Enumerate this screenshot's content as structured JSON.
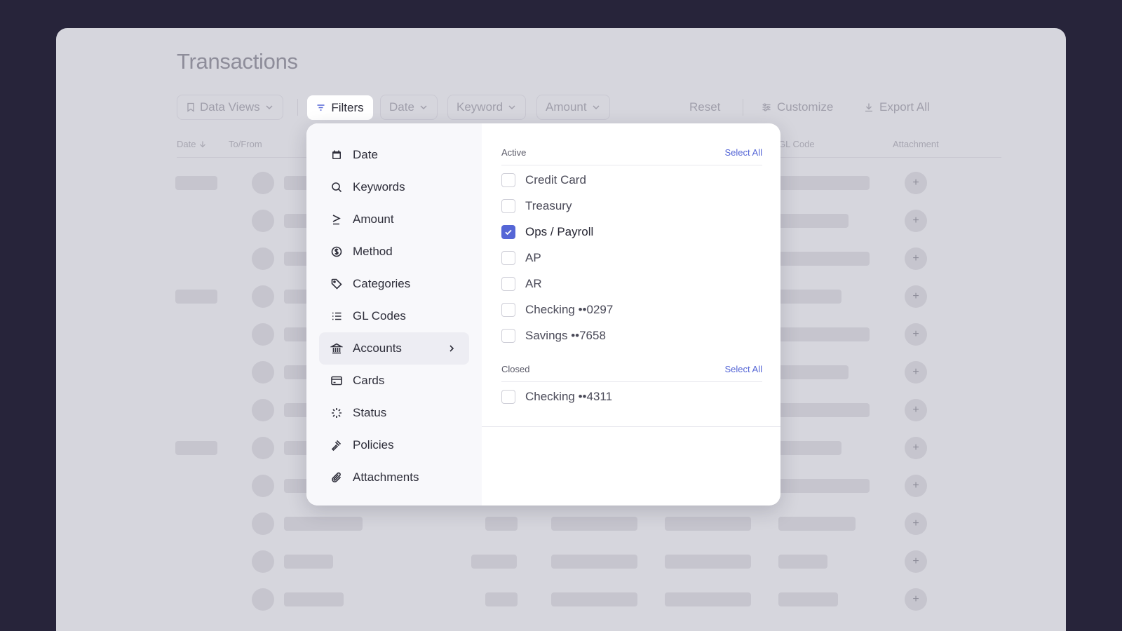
{
  "page": {
    "title": "Transactions"
  },
  "toolbar": {
    "data_views": "Data Views",
    "filters": "Filters",
    "date": "Date",
    "keyword": "Keyword",
    "amount": "Amount",
    "reset": "Reset",
    "customize": "Customize",
    "export_all": "Export All"
  },
  "table": {
    "headers": {
      "date": "Date",
      "to_from": "To/From",
      "gl_code": "GL Code",
      "attachment": "Attachment"
    },
    "add_symbol": "+"
  },
  "filter_menu": {
    "categories": [
      {
        "label": "Date",
        "icon": "calendar-icon"
      },
      {
        "label": "Keywords",
        "icon": "search-icon"
      },
      {
        "label": "Amount",
        "icon": "greater-equal-icon"
      },
      {
        "label": "Method",
        "icon": "dollar-circle-icon"
      },
      {
        "label": "Categories",
        "icon": "tag-icon"
      },
      {
        "label": "GL Codes",
        "icon": "list-icon"
      },
      {
        "label": "Accounts",
        "icon": "bank-icon",
        "active": true
      },
      {
        "label": "Cards",
        "icon": "card-icon"
      },
      {
        "label": "Status",
        "icon": "loader-icon"
      },
      {
        "label": "Policies",
        "icon": "gavel-icon"
      },
      {
        "label": "Attachments",
        "icon": "paperclip-icon"
      }
    ],
    "accounts": {
      "active_label": "Active",
      "closed_label": "Closed",
      "select_all": "Select All",
      "active": [
        {
          "label": "Credit Card",
          "checked": false
        },
        {
          "label": "Treasury",
          "checked": false
        },
        {
          "label": "Ops / Payroll",
          "checked": true
        },
        {
          "label": "AP",
          "checked": false
        },
        {
          "label": "AR",
          "checked": false
        },
        {
          "label": "Checking ••0297",
          "checked": false
        },
        {
          "label": "Savings ••7658",
          "checked": false
        }
      ],
      "closed": [
        {
          "label": "Checking ••4311",
          "checked": false
        }
      ]
    }
  },
  "colors": {
    "accent": "#5566d6",
    "backdrop": "#27243a"
  }
}
